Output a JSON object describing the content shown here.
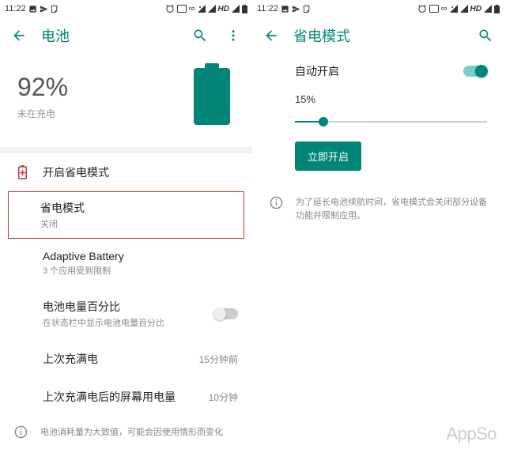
{
  "status": {
    "time": "11:22",
    "hd": "HD"
  },
  "left": {
    "title": "电池",
    "pct": "92%",
    "pct_sub": "未在充电",
    "saver_header": "开启省电模式",
    "saver_mode": {
      "title": "省电模式",
      "sub": "关闭"
    },
    "adaptive": {
      "title": "Adaptive Battery",
      "sub": "3 个应用受到限制"
    },
    "pct_row": {
      "title": "电池电量百分比",
      "sub": "在状态栏中显示电池电量百分比"
    },
    "last_full": {
      "title": "上次充满电",
      "meta": "15分钟前"
    },
    "screen_since": {
      "title": "上次充满电后的屏幕用电量",
      "meta": "10分钟"
    },
    "footer": "电池消耗量为大致值，可能会因使用情形而变化"
  },
  "right": {
    "title": "省电模式",
    "auto_on": "自动开启",
    "threshold": "15%",
    "enable_now": "立即开启",
    "info": "为了延长电池续航时间，省电模式会关闭部分设备功能并限制应用。"
  },
  "watermark": "AppSo"
}
